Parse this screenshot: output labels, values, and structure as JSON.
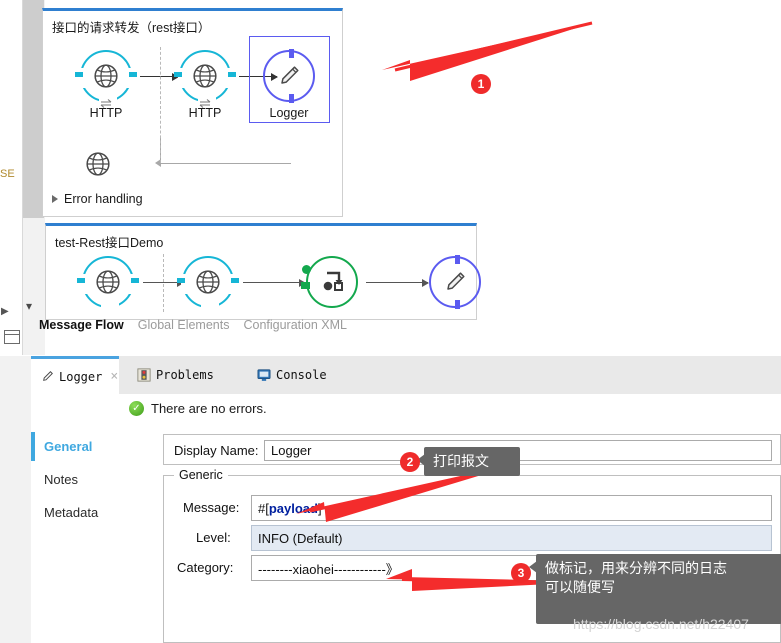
{
  "canvas": {
    "flow1": {
      "title": "接口的请求转发（rest接口）",
      "nodes": [
        {
          "label": "HTTP",
          "icon": "globe-icon"
        },
        {
          "label": "HTTP",
          "icon": "globe-icon"
        },
        {
          "label": "Logger",
          "icon": "pencil-icon"
        }
      ],
      "error_node_icon": "globe-icon",
      "error_handling_label": "Error handling"
    },
    "flow2": {
      "title": "test-Rest接口Demo",
      "nodes": [
        {
          "label": "",
          "icon": "globe-icon"
        },
        {
          "label": "",
          "icon": "globe-icon"
        },
        {
          "label": "",
          "icon": "transform-icon"
        },
        {
          "label": "",
          "icon": "pencil-icon"
        }
      ]
    },
    "flow_tabs": [
      {
        "label": "Message Flow",
        "active": true
      },
      {
        "label": "Global Elements",
        "active": false
      },
      {
        "label": "Configuration XML",
        "active": false
      }
    ]
  },
  "rail": {
    "label": "SE",
    "icon": "panel-icon",
    "chevron": "chevron-down-icon"
  },
  "properties": {
    "tabs": [
      {
        "label": "Logger",
        "icon": "pencil-icon",
        "active": true,
        "close": "×"
      },
      {
        "label": "Problems",
        "icon": "problems-icon",
        "active": false
      },
      {
        "label": "Console",
        "icon": "console-icon",
        "active": false
      }
    ],
    "status": {
      "icon": "check-circle-icon",
      "text": "There are no errors."
    },
    "nav": [
      {
        "label": "General",
        "active": true
      },
      {
        "label": "Notes",
        "active": false
      },
      {
        "label": "Metadata",
        "active": false
      }
    ],
    "display_name": {
      "label": "Display Name:",
      "value": "Logger"
    },
    "generic": {
      "title": "Generic",
      "fields": [
        {
          "label": "Message:",
          "value_prefix": "#[",
          "value_bold": "payload",
          "value_suffix": "]",
          "readonly": false
        },
        {
          "label": "Level:",
          "value": "INFO (Default)",
          "readonly": true
        },
        {
          "label": "Category:",
          "value": "--------xiaohei------------》",
          "readonly": false
        }
      ]
    }
  },
  "annotations": {
    "badges": [
      "1",
      "2",
      "3"
    ],
    "tip2": "打印报文",
    "tip3_line1": "做标记，用来分辨不同的日志",
    "tip3_line2": "可以随便写",
    "watermark": "https://blog.csdn.net/h22407",
    "accent_red": "#ef2b2b"
  }
}
